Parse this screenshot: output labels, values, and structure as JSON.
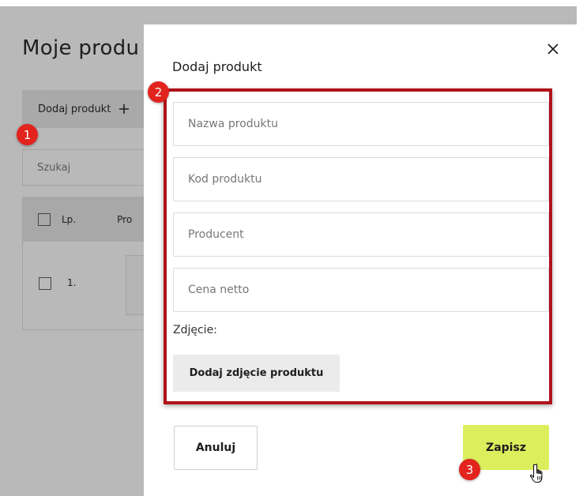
{
  "background": {
    "title": "Moje produ",
    "add_product_label": "Dodaj produkt",
    "add_icon": "plus-icon",
    "search_placeholder": "Szukaj",
    "table": {
      "col_lp": "Lp.",
      "col_product": "Pro",
      "rows": [
        {
          "lp": "1."
        }
      ]
    }
  },
  "modal": {
    "title": "Dodaj produkt",
    "close_icon": "close-icon",
    "fields": {
      "name_placeholder": "Nazwa produktu",
      "code_placeholder": "Kod produktu",
      "producer_placeholder": "Producent",
      "price_placeholder": "Cena netto"
    },
    "photo_label": "Zdjęcie:",
    "add_photo_label": "Dodaj zdjęcie produktu",
    "cancel_label": "Anuluj",
    "save_label": "Zapisz"
  },
  "annotations": {
    "step1": "1",
    "step2": "2",
    "step3": "3"
  },
  "colors": {
    "accent_save": "#dcee5c",
    "highlight_border": "#b0121a",
    "badge": "#e3231e",
    "overlay": "#b9b9b9"
  }
}
